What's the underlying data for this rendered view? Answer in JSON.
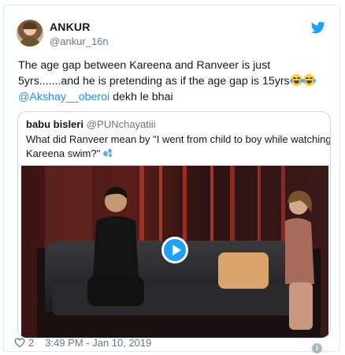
{
  "author": {
    "name": "ANKUR",
    "handle": "@ankur_16n"
  },
  "tweet": {
    "line1": "The age gap between Kareena and Ranveer is just",
    "line2": "5yrs.......and he is pretending as if the age gap is 15yrs",
    "mention": "@Akshay__oberoi",
    "line3_rest": " dekh le bhai",
    "emojis": [
      "face-with-tears-of-joy-icon",
      "face-with-tears-of-joy-icon"
    ]
  },
  "quoted": {
    "name": "babu bisleri",
    "handle": "@PUNchayatiii",
    "line1": "What did Ranveer mean by \"I went from child to boy while watching",
    "line2": "Kareena swim?\""
  },
  "footer": {
    "likes": "2",
    "timestamp": "3:49 PM - Jan 10, 2019"
  },
  "colors": {
    "twitter_blue": "#1da1f2",
    "link_blue": "#1b95e0",
    "muted_gray": "#657786",
    "border": "#e1e8ed"
  }
}
